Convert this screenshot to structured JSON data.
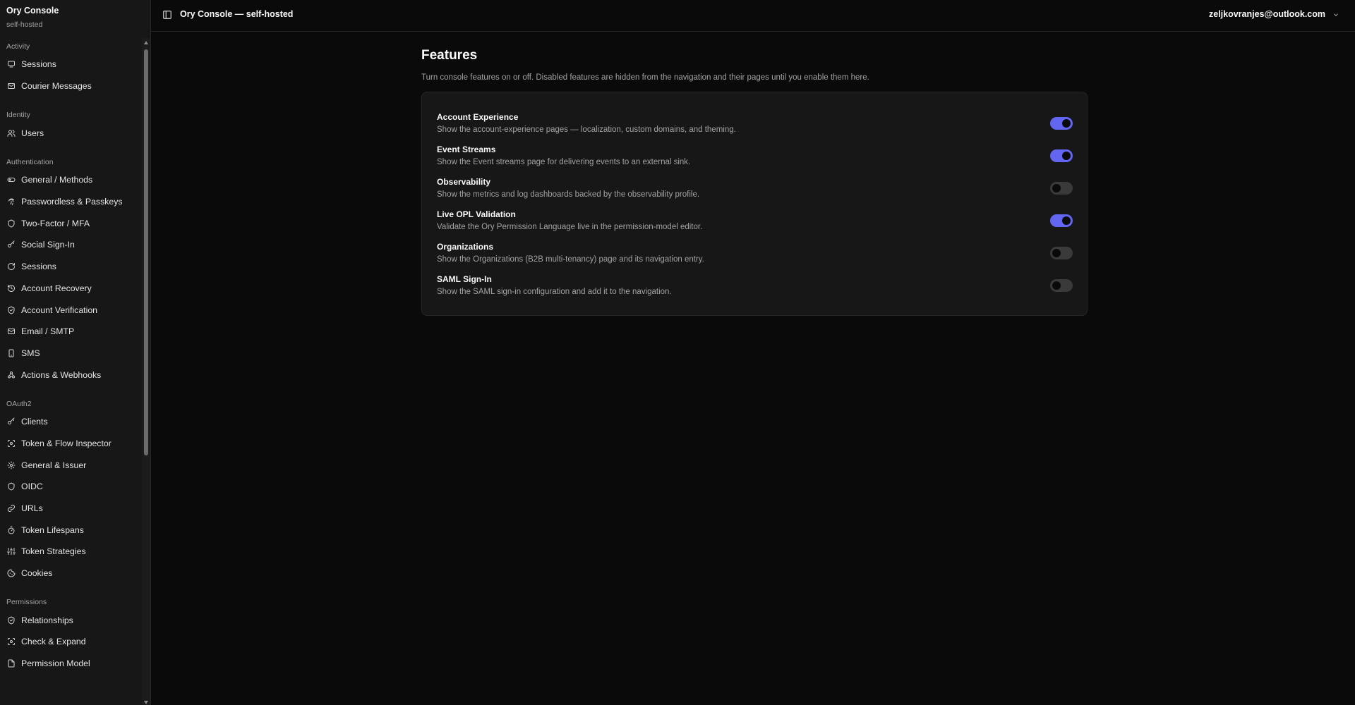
{
  "brand": {
    "title": "Ory Console",
    "subtitle": "self-hosted"
  },
  "header": {
    "title": "Ory Console — self-hosted",
    "user_email": "zeljkovranjes@outlook.com"
  },
  "sidebar": {
    "groups": [
      {
        "label": "Activity",
        "items": [
          {
            "label": "Sessions",
            "icon": "sessions-icon"
          },
          {
            "label": "Courier Messages",
            "icon": "mail-icon"
          }
        ]
      },
      {
        "label": "Identity",
        "items": [
          {
            "label": "Users",
            "icon": "users-icon"
          }
        ]
      },
      {
        "label": "Authentication",
        "items": [
          {
            "label": "General / Methods",
            "icon": "toggle-icon"
          },
          {
            "label": "Passwordless & Passkeys",
            "icon": "fingerprint-icon"
          },
          {
            "label": "Two-Factor / MFA",
            "icon": "shield-icon"
          },
          {
            "label": "Social Sign-In",
            "icon": "key-icon"
          },
          {
            "label": "Sessions",
            "icon": "refresh-icon"
          },
          {
            "label": "Account Recovery",
            "icon": "history-icon"
          },
          {
            "label": "Account Verification",
            "icon": "shield-check-icon"
          },
          {
            "label": "Email / SMTP",
            "icon": "mail-icon"
          },
          {
            "label": "SMS",
            "icon": "phone-icon"
          },
          {
            "label": "Actions & Webhooks",
            "icon": "webhook-icon"
          }
        ]
      },
      {
        "label": "OAuth2",
        "items": [
          {
            "label": "Clients",
            "icon": "key-icon"
          },
          {
            "label": "Token & Flow Inspector",
            "icon": "scan-icon"
          },
          {
            "label": "General & Issuer",
            "icon": "gear-icon"
          },
          {
            "label": "OIDC",
            "icon": "shield-icon"
          },
          {
            "label": "URLs",
            "icon": "link-icon"
          },
          {
            "label": "Token Lifespans",
            "icon": "timer-icon"
          },
          {
            "label": "Token Strategies",
            "icon": "sliders-icon"
          },
          {
            "label": "Cookies",
            "icon": "cookie-icon"
          }
        ]
      },
      {
        "label": "Permissions",
        "items": [
          {
            "label": "Relationships",
            "icon": "shield-check-icon"
          },
          {
            "label": "Check & Expand",
            "icon": "scan-icon"
          },
          {
            "label": "Permission Model",
            "icon": "file-icon"
          }
        ]
      }
    ]
  },
  "main": {
    "title": "Features",
    "description": "Turn console features on or off. Disabled features are hidden from the navigation and their pages until you enable them here.",
    "features": [
      {
        "title": "Account Experience",
        "description": "Show the account-experience pages — localization, custom domains, and theming.",
        "enabled": true
      },
      {
        "title": "Event Streams",
        "description": "Show the Event streams page for delivering events to an external sink.",
        "enabled": true
      },
      {
        "title": "Observability",
        "description": "Show the metrics and log dashboards backed by the observability profile.",
        "enabled": false
      },
      {
        "title": "Live OPL Validation",
        "description": "Validate the Ory Permission Language live in the permission-model editor.",
        "enabled": true
      },
      {
        "title": "Organizations",
        "description": "Show the Organizations (B2B multi-tenancy) page and its navigation entry.",
        "enabled": false
      },
      {
        "title": "SAML Sign-In",
        "description": "Show the SAML sign-in configuration and add it to the navigation.",
        "enabled": false
      }
    ]
  },
  "colors": {
    "accent": "#6366f1",
    "background": "#0a0a0a",
    "sidebar": "#171717",
    "card": "#171717",
    "muted_text": "#a3a3a3"
  }
}
